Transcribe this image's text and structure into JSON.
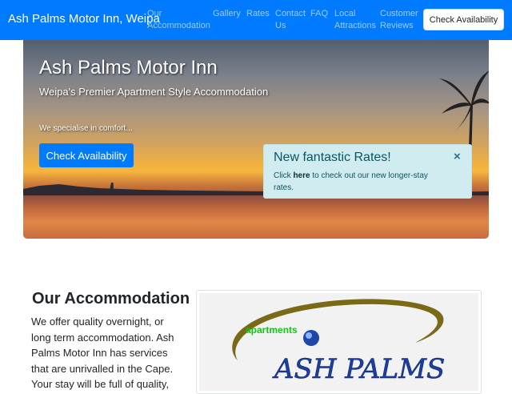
{
  "navbar": {
    "brand": "Ash Palms Motor Inn, Weipa",
    "items": [
      {
        "line1": "Our",
        "line2": "Accommodation"
      },
      {
        "line1": "Gallery",
        "line2": ""
      },
      {
        "line1": "Rates",
        "line2": ""
      },
      {
        "line1": "Contact",
        "line2": "Us"
      },
      {
        "line1": "FAQ",
        "line2": ""
      },
      {
        "line1": "Local",
        "line2": "Attractions"
      },
      {
        "line1": "Customer",
        "line2": "Reviews"
      }
    ],
    "check_button": "Check Availability"
  },
  "hero": {
    "title": "Ash Palms Motor Inn",
    "subtitle": "Weipa's Premier Apartment Style Accommodation",
    "tagline": "We specialise in comfort...",
    "button": "Check Availability"
  },
  "alert": {
    "title": "New fantastic Rates!",
    "pre": "Click ",
    "link": "here",
    "post": " to check out our new longer-stay rates.",
    "close": "×"
  },
  "accommodation": {
    "title": "Our Accommodation",
    "text": "We offer quality overnight, or long term accommodation. Ash Palms Motor Inn has services that are unrivalled in the Cape. Your stay will be full of quality,"
  },
  "logo": {
    "apartments": "apartments",
    "name": "ASH PALMS"
  },
  "colors": {
    "primary": "#007bff",
    "alert_bg": "#d1ecf1",
    "alert_text": "#0c5460",
    "logo_green": "#16c31a",
    "logo_olive": "#7a6a18",
    "logo_blue": "#1f46a8"
  }
}
